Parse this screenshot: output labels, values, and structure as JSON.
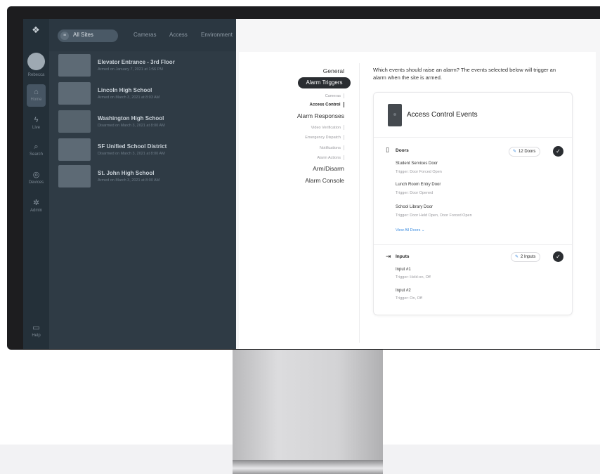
{
  "app": {
    "rail": {
      "user_name": "Rebecca",
      "items": [
        {
          "label": "Home",
          "icon": "home-icon"
        },
        {
          "label": "Live",
          "icon": "live-icon"
        },
        {
          "label": "Search",
          "icon": "search-icon"
        },
        {
          "label": "Devices",
          "icon": "devices-icon"
        },
        {
          "label": "Admin",
          "icon": "admin-icon"
        },
        {
          "label": "Help",
          "icon": "help-icon"
        }
      ]
    },
    "topbar": {
      "site_selector": "All Sites",
      "tabs": [
        "Cameras",
        "Access",
        "Environment"
      ]
    },
    "sites": [
      {
        "name": "Elevator Entrance - 3rd Floor",
        "status": "Armed on January 7, 2021 at 1:56 PM"
      },
      {
        "name": "Lincoln High School",
        "status": "Armed on March 3, 2021 at 8:03 AM"
      },
      {
        "name": "Washington High School",
        "status": "Disarmed on March 3, 2021 at 8:00 AM"
      },
      {
        "name": "SF Unified School District",
        "status": "Disarmed on March 3, 2021 at 8:00 AM"
      },
      {
        "name": "St. John High School",
        "status": "Armed on March 3, 2021 at 8:00 AM"
      }
    ]
  },
  "settings": {
    "nav": {
      "general": "General",
      "alarm_triggers": "Alarm Triggers",
      "cameras": "Cameras",
      "access_control": "Access Control",
      "alarm_responses": "Alarm Responses",
      "video_verification": "Video Verification",
      "emergency_dispatch": "Emergency Dispatch",
      "notifications": "Notifications",
      "alarm_actions": "Alarm Actions",
      "arm_disarm": "Arm/Disarm",
      "alarm_console": "Alarm Console"
    },
    "intro": "Which events should raise an alarm? The events selected below will trigger an alarm when the site is armed.",
    "card": {
      "title": "Access Control Events",
      "doors": {
        "label": "Doors",
        "chip": "12 Doors",
        "items": [
          {
            "name": "Student Services Door",
            "trigger": "Trigger: Door Forced Open"
          },
          {
            "name": "Lunch Room Entry Door",
            "trigger": "Trigger: Door Opened"
          },
          {
            "name": "School Library Door",
            "trigger": "Trigger: Door Held Open, Door Forced Open"
          }
        ],
        "view_all": "View All Doors"
      },
      "inputs": {
        "label": "Inputs",
        "chip": "2 Inputs",
        "items": [
          {
            "name": "Input #1",
            "trigger": "Trigger: Held-on, Off"
          },
          {
            "name": "Input #2",
            "trigger": "Trigger: On, Off"
          }
        ]
      }
    }
  }
}
